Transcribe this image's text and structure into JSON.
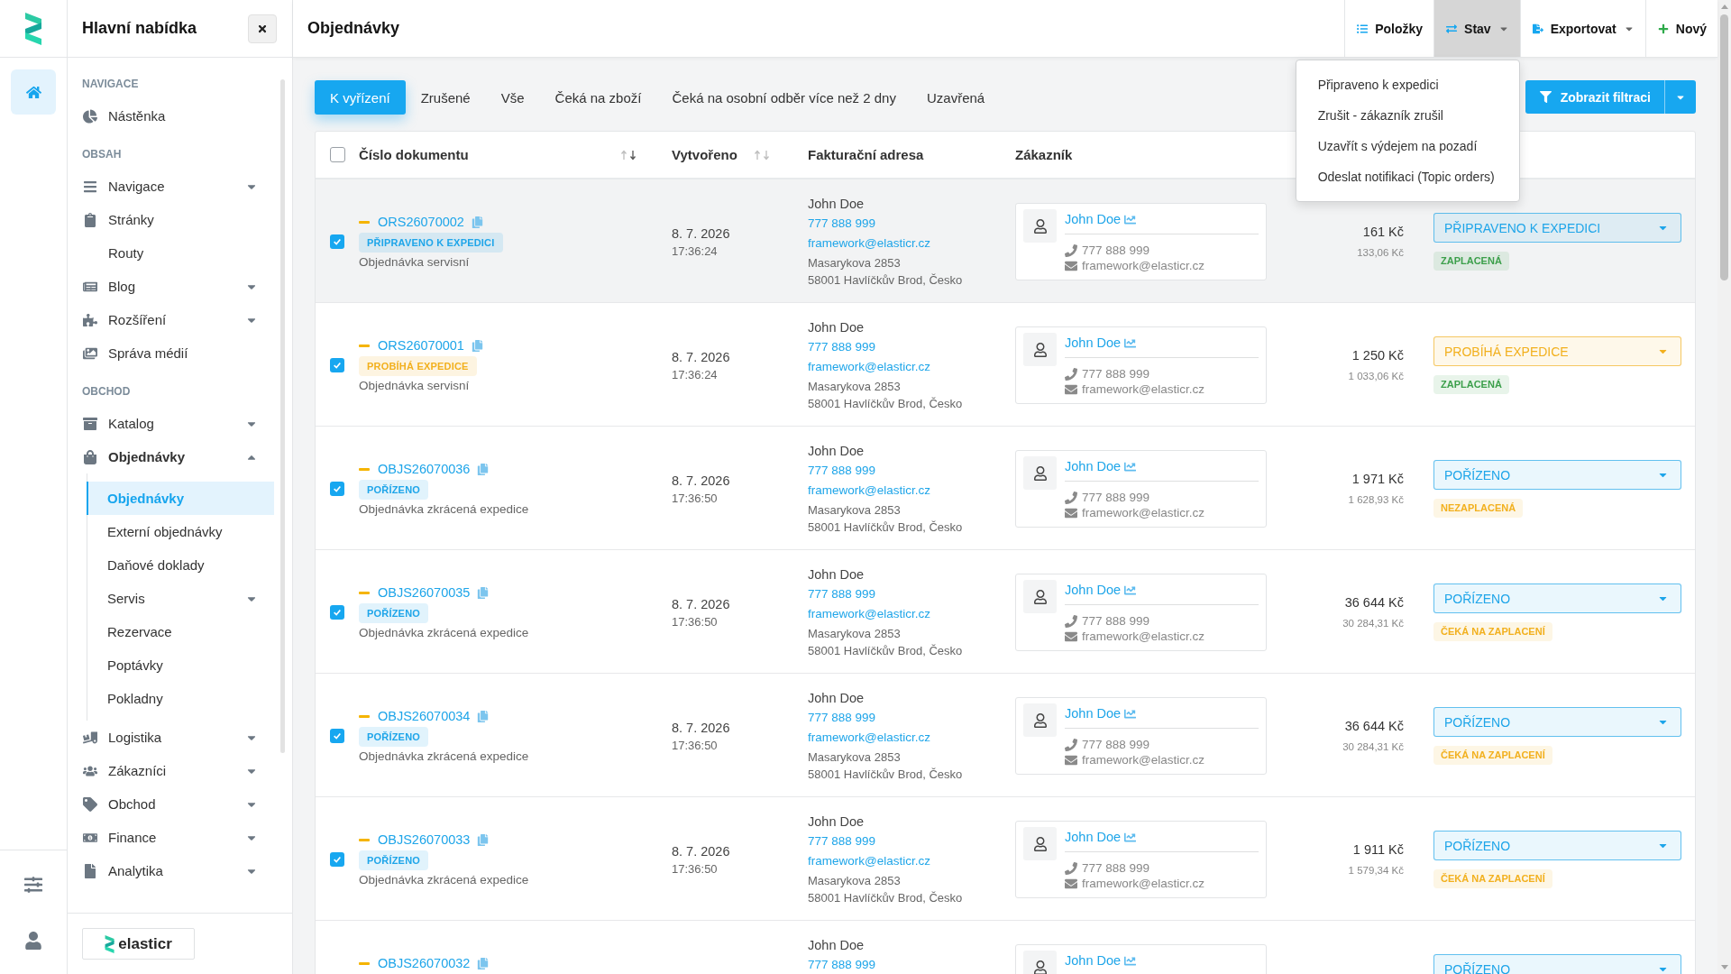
{
  "rail": {
    "top": [
      {
        "kind": "home",
        "selected": true
      }
    ],
    "bottom": [
      {
        "kind": "settings",
        "selected": false
      },
      {
        "kind": "user",
        "selected": false
      }
    ]
  },
  "sidebar": {
    "title": "Hlavní nabídka",
    "sections": [
      {
        "heading": "NAVIGACE",
        "items": [
          {
            "label": "Nástěnka",
            "kind": "dashboard",
            "selected": false
          }
        ]
      },
      {
        "heading": "OBSAH",
        "items": [
          {
            "label": "Navigace",
            "kind": "menu",
            "selected": false,
            "expanded": false
          },
          {
            "label": "Stránky",
            "kind": "pages",
            "selected": false
          },
          {
            "label": "Routy",
            "kind": "plain",
            "selected": false
          },
          {
            "label": "Blog",
            "kind": "blog",
            "selected": false,
            "expanded": false
          },
          {
            "label": "Rozšíření",
            "kind": "extensions",
            "selected": false,
            "expanded": false
          },
          {
            "label": "Správa médií",
            "kind": "media",
            "selected": false
          }
        ]
      },
      {
        "heading": "OBCHOD",
        "items": [
          {
            "label": "Katalog",
            "kind": "catalog",
            "selected": false,
            "expanded": false
          },
          {
            "label": "Objednávky",
            "kind": "orders",
            "selected": false,
            "expanded": true,
            "children": [
              {
                "label": "Objednávky",
                "selected": true
              },
              {
                "label": "Externí objednávky",
                "selected": false
              },
              {
                "label": "Daňové doklady",
                "selected": false
              },
              {
                "label": "Servis",
                "selected": false,
                "expanded": false
              },
              {
                "label": "Rezervace",
                "selected": false
              },
              {
                "label": "Poptávky",
                "selected": false
              },
              {
                "label": "Pokladny",
                "selected": false
              }
            ]
          },
          {
            "label": "Logistika",
            "kind": "logistics",
            "selected": false,
            "expanded": false
          },
          {
            "label": "Zákazníci",
            "kind": "customers",
            "selected": false,
            "expanded": false
          },
          {
            "label": "Obchod",
            "kind": "sales",
            "selected": false,
            "expanded": false
          },
          {
            "label": "Finance",
            "kind": "finance",
            "selected": false,
            "expanded": false
          },
          {
            "label": "Analytika",
            "kind": "analytics",
            "selected": false,
            "expanded": false
          }
        ]
      }
    ],
    "brand": "elasticr"
  },
  "page": {
    "title": "Objednávky",
    "toolbar": [
      {
        "label": "Položky",
        "kind": "list",
        "dropdown": false,
        "open": false
      },
      {
        "label": "Stav",
        "kind": "status",
        "dropdown": true,
        "open": true,
        "menu": [
          "Připraveno k expedici",
          "Zrušit - zákazník zrušil",
          "Uzavřít s výdejem na pozadí",
          "Odeslat notifikaci (Topic orders)"
        ]
      },
      {
        "label": "Exportovat",
        "kind": "export",
        "dropdown": true,
        "open": false
      },
      {
        "label": "Nový",
        "kind": "new",
        "dropdown": false,
        "open": false
      }
    ]
  },
  "tabs": [
    {
      "label": "K vyřízení",
      "selected": true
    },
    {
      "label": "Zrušené",
      "selected": false
    },
    {
      "label": "Vše",
      "selected": false
    },
    {
      "label": "Čeká na zboží",
      "selected": false
    },
    {
      "label": "Čeká na osobní odběr více než 2 dny",
      "selected": false
    },
    {
      "label": "Uzavřená",
      "selected": false
    }
  ],
  "filter_button": {
    "label": "Zobrazit filtraci"
  },
  "table": {
    "select_all": {
      "checked": false
    },
    "columns": [
      {
        "label": "Číslo dokumentu",
        "sorted": true
      },
      {
        "label": "Vytvořeno",
        "sorted": false
      },
      {
        "label": "Fakturační adresa"
      },
      {
        "label": "Zákazník"
      }
    ],
    "rows": [
      {
        "hovered": true,
        "checked": true,
        "number": "ORS26070002",
        "badge": {
          "label": "PŘIPRAVENO K EXPEDICI",
          "color": "#1ea5e9"
        },
        "type": "Objednávka servisní",
        "date": "8. 7. 2026",
        "time": "17:36:24",
        "billing": {
          "name": "John Doe",
          "phone": "777 888 999",
          "email": "framework@elasticr.cz",
          "street": "Masarykova 2853",
          "city": "58001 Havlíčkův Brod, Česko"
        },
        "customer": {
          "name": "John Doe",
          "phone": "777 888 999",
          "email": "framework@elasticr.cz"
        },
        "total": "161 Kč",
        "net": "133,06 Kč",
        "status": {
          "label": "PŘIPRAVENO K EXPEDICI",
          "color": "#1ea5e9"
        },
        "payment": {
          "label": "ZAPLACENÁ",
          "color": "#3c9f4b"
        }
      },
      {
        "hovered": false,
        "checked": true,
        "number": "ORS26070001",
        "badge": {
          "label": "PROBÍHÁ EXPEDICE",
          "color": "#f2b01e"
        },
        "type": "Objednávka servisní",
        "date": "8. 7. 2026",
        "time": "17:36:24",
        "billing": {
          "name": "John Doe",
          "phone": "777 888 999",
          "email": "framework@elasticr.cz",
          "street": "Masarykova 2853",
          "city": "58001 Havlíčkův Brod, Česko"
        },
        "customer": {
          "name": "John Doe",
          "phone": "777 888 999",
          "email": "framework@elasticr.cz"
        },
        "total": "1 250 Kč",
        "net": "1 033,06 Kč",
        "status": {
          "label": "PROBÍHÁ EXPEDICE",
          "color": "#f2b01e"
        },
        "payment": {
          "label": "ZAPLACENÁ",
          "color": "#3c9f4b"
        }
      },
      {
        "hovered": false,
        "checked": true,
        "number": "OBJS26070036",
        "badge": {
          "label": "POŘÍZENO",
          "color": "#1ea5e9"
        },
        "type": "Objednávka zkrácená expedice",
        "date": "8. 7. 2026",
        "time": "17:36:50",
        "billing": {
          "name": "John Doe",
          "phone": "777 888 999",
          "email": "framework@elasticr.cz",
          "street": "Masarykova 2853",
          "city": "58001 Havlíčkův Brod, Česko"
        },
        "customer": {
          "name": "John Doe",
          "phone": "777 888 999",
          "email": "framework@elasticr.cz"
        },
        "total": "1 971 Kč",
        "net": "1 628,93 Kč",
        "status": {
          "label": "POŘÍZENO",
          "color": "#1ea5e9"
        },
        "payment": {
          "label": "NEZAPLACENÁ",
          "color": "#f2b01e"
        }
      },
      {
        "hovered": false,
        "checked": true,
        "number": "OBJS26070035",
        "badge": {
          "label": "POŘÍZENO",
          "color": "#1ea5e9"
        },
        "type": "Objednávka zkrácená expedice",
        "date": "8. 7. 2026",
        "time": "17:36:50",
        "billing": {
          "name": "John Doe",
          "phone": "777 888 999",
          "email": "framework@elasticr.cz",
          "street": "Masarykova 2853",
          "city": "58001 Havlíčkův Brod, Česko"
        },
        "customer": {
          "name": "John Doe",
          "phone": "777 888 999",
          "email": "framework@elasticr.cz"
        },
        "total": "36 644 Kč",
        "net": "30 284,31 Kč",
        "status": {
          "label": "POŘÍZENO",
          "color": "#1ea5e9"
        },
        "payment": {
          "label": "ČEKÁ NA ZAPLACENÍ",
          "color": "#f2b01e"
        }
      },
      {
        "hovered": false,
        "checked": true,
        "number": "OBJS26070034",
        "badge": {
          "label": "POŘÍZENO",
          "color": "#1ea5e9"
        },
        "type": "Objednávka zkrácená expedice",
        "date": "8. 7. 2026",
        "time": "17:36:50",
        "billing": {
          "name": "John Doe",
          "phone": "777 888 999",
          "email": "framework@elasticr.cz",
          "street": "Masarykova 2853",
          "city": "58001 Havlíčkův Brod, Česko"
        },
        "customer": {
          "name": "John Doe",
          "phone": "777 888 999",
          "email": "framework@elasticr.cz"
        },
        "total": "36 644 Kč",
        "net": "30 284,31 Kč",
        "status": {
          "label": "POŘÍZENO",
          "color": "#1ea5e9"
        },
        "payment": {
          "label": "ČEKÁ NA ZAPLACENÍ",
          "color": "#f2b01e"
        }
      },
      {
        "hovered": false,
        "checked": true,
        "number": "OBJS26070033",
        "badge": {
          "label": "POŘÍZENO",
          "color": "#1ea5e9"
        },
        "type": "Objednávka zkrácená expedice",
        "date": "8. 7. 2026",
        "time": "17:36:50",
        "billing": {
          "name": "John Doe",
          "phone": "777 888 999",
          "email": "framework@elasticr.cz",
          "street": "Masarykova 2853",
          "city": "58001 Havlíčkův Brod, Česko"
        },
        "customer": {
          "name": "John Doe",
          "phone": "777 888 999",
          "email": "framework@elasticr.cz"
        },
        "total": "1 911 Kč",
        "net": "1 579,34 Kč",
        "status": {
          "label": "POŘÍZENO",
          "color": "#1ea5e9"
        },
        "payment": {
          "label": "ČEKÁ NA ZAPLACENÍ",
          "color": "#f2b01e"
        }
      },
      {
        "number": "OBJS26070032",
        "billing": {
          "name": "John Doe",
          "phone": "777 888 999"
        },
        "customer": {
          "name": "John Doe"
        },
        "status": {
          "label": "POŘÍZENO",
          "color": "#1ea5e9"
        }
      }
    ]
  }
}
